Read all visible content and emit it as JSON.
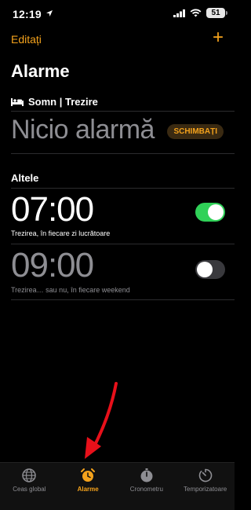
{
  "status_bar": {
    "time": "12:19",
    "battery": "51"
  },
  "nav": {
    "edit_label": "Editați",
    "add_label": "+"
  },
  "page": {
    "title": "Alarme"
  },
  "sleep_section": {
    "header": "Somn | Trezire",
    "no_alarm_text": "Nicio alarmă",
    "change_button": "SCHIMBAȚI"
  },
  "others_section": {
    "header": "Altele",
    "alarms": [
      {
        "time": "07:00",
        "label": "Trezirea, în fiecare zi lucrătoare",
        "enabled": true
      },
      {
        "time": "09:00",
        "label": "Trezirea… sau nu, în fiecare weekend",
        "enabled": false
      }
    ]
  },
  "tab_bar": {
    "tabs": [
      {
        "label": "Ceas global",
        "icon": "globe-icon",
        "active": false
      },
      {
        "label": "Alarme",
        "icon": "alarm-clock-icon",
        "active": true
      },
      {
        "label": "Cronometru",
        "icon": "stopwatch-icon",
        "active": false
      },
      {
        "label": "Temporizatoare",
        "icon": "timer-icon",
        "active": false
      }
    ]
  },
  "colors": {
    "accent": "#f4a21c",
    "toggle_on": "#30d158",
    "annotation_arrow": "#e8101a"
  }
}
